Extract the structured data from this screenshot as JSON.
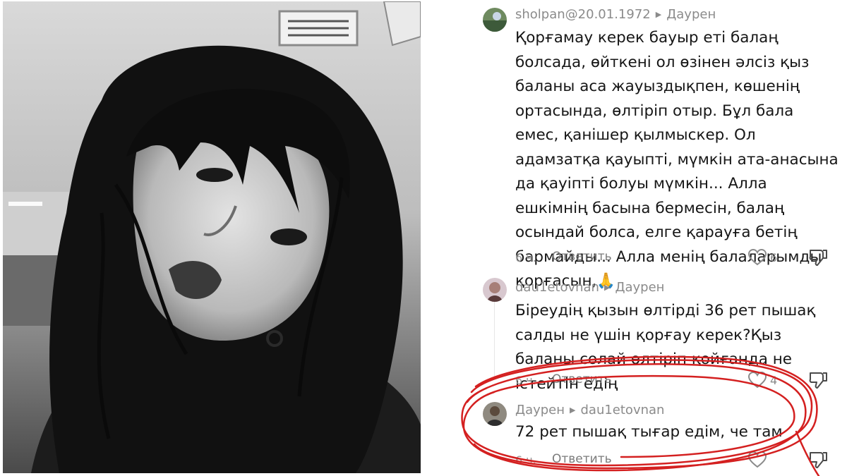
{
  "photo": {
    "icon": "portrait-photo-icon"
  },
  "comments": [
    {
      "author": "sholpan@20.01.1972",
      "reply_to": "Даурен",
      "text": "Қорғамау керек бауыр еті балаң болсада, өйткені ол өзінен әлсіз қыз баланы аса жауыздықпен, көшенің ортасында, өлтіріп отыр. Бұл бала емес, қанішер қылмыскер. Ол адамзатқа қауыпті, мүмкін ата-анасына да қауіпті болуы мүмкін... Алла ешкімнің басына бермесін, балаң осындай болса, елге қарауға бетің бармайды... Алла менің балаларымды қорғасын,🙏",
      "time": "6 ч.",
      "reply_label": "Ответить",
      "likes": "6"
    },
    {
      "author": "dau1etovnan",
      "reply_to": "Даурен",
      "text": "Біреудің қызын өлтірді 36 рет пышақ салды не үшін қорғау керек?Қыз баланы солай өлтіріп қойғанда не істейтін едің",
      "time": "6 ч.",
      "reply_label": "Ответить",
      "likes": "4"
    },
    {
      "author": "Даурен",
      "reply_to": "dau1etovnan",
      "text": "72 рет пышақ тығар едім, че там",
      "time": "6 ч.",
      "reply_label": "Ответить"
    }
  ],
  "colors": {
    "annotation": "#d42020",
    "text": "#161616",
    "muted": "#8b8b8b"
  }
}
